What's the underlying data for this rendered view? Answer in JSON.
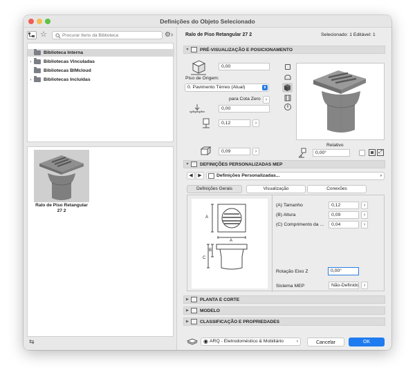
{
  "window": {
    "title": "Definições do Objeto Selecionado"
  },
  "library": {
    "search_placeholder": "Procurar Itens da Biblioteca",
    "items": [
      {
        "label": "Biblioteca Interna",
        "expandable": false,
        "selected": true
      },
      {
        "label": "Bibliotecas Vinculadas",
        "expandable": true
      },
      {
        "label": "Bibliotecas BIMcloud",
        "expandable": false
      },
      {
        "label": "Bibliotecas Incluídas",
        "expandable": true
      }
    ],
    "thumbnail_label": "Ralo de Piso Retangular 27 2"
  },
  "header": {
    "object_name": "Ralo de Piso Retangular 27 2",
    "selection_info": "Selecionado: 1 Editável: 1"
  },
  "preview_section": {
    "title": "PRÉ-VISUALIZAÇÃO E POSICIONAMENTO",
    "elevation_value": "0,00",
    "piso_label": "Piso de Origem:",
    "piso_value": "0. Pavimento Térreo (Atual)",
    "cota_label": "para Cota Zero",
    "cota_value": "0,00",
    "height_value": "0,12",
    "depth_value": "0,09",
    "relativo_label": "Relativo",
    "angle_value": "0,00°"
  },
  "mep_section": {
    "title": "DEFINIÇÕES PERSONALIZADAS MEP",
    "dropdown_value": "Definições Personalizadas...",
    "tabs": [
      "Definições Gerais",
      "Visualização",
      "Conexões"
    ],
    "params": [
      {
        "label": "(A) Tamanho",
        "value": "0,12"
      },
      {
        "label": "(B) Altura",
        "value": "0,09"
      },
      {
        "label": "(C) Comprimento da ...",
        "value": "0,04"
      }
    ],
    "rotation_label": "Rotação Eixo Z",
    "rotation_value": "0,00°",
    "sistema_label": "Sistema MEP",
    "sistema_value": "Não-Definido",
    "diagram_labels": {
      "a": "A",
      "b": "B",
      "c": "C"
    }
  },
  "collapsed_sections": [
    "PLANTA E CORTE",
    "MODELO",
    "CLASSIFICAÇÃO E PROPRIEDADES"
  ],
  "footer": {
    "layer_value": "ARQ - Eletrodoméstico & Mobiliário",
    "cancel_label": "Cancelar",
    "ok_label": "OK"
  },
  "colors": {
    "accent": "#2a7de1",
    "ok_button": "#1f7cf0",
    "close": "#ee5f57",
    "minimize": "#f5bd4f",
    "maximize": "#5ec343"
  }
}
